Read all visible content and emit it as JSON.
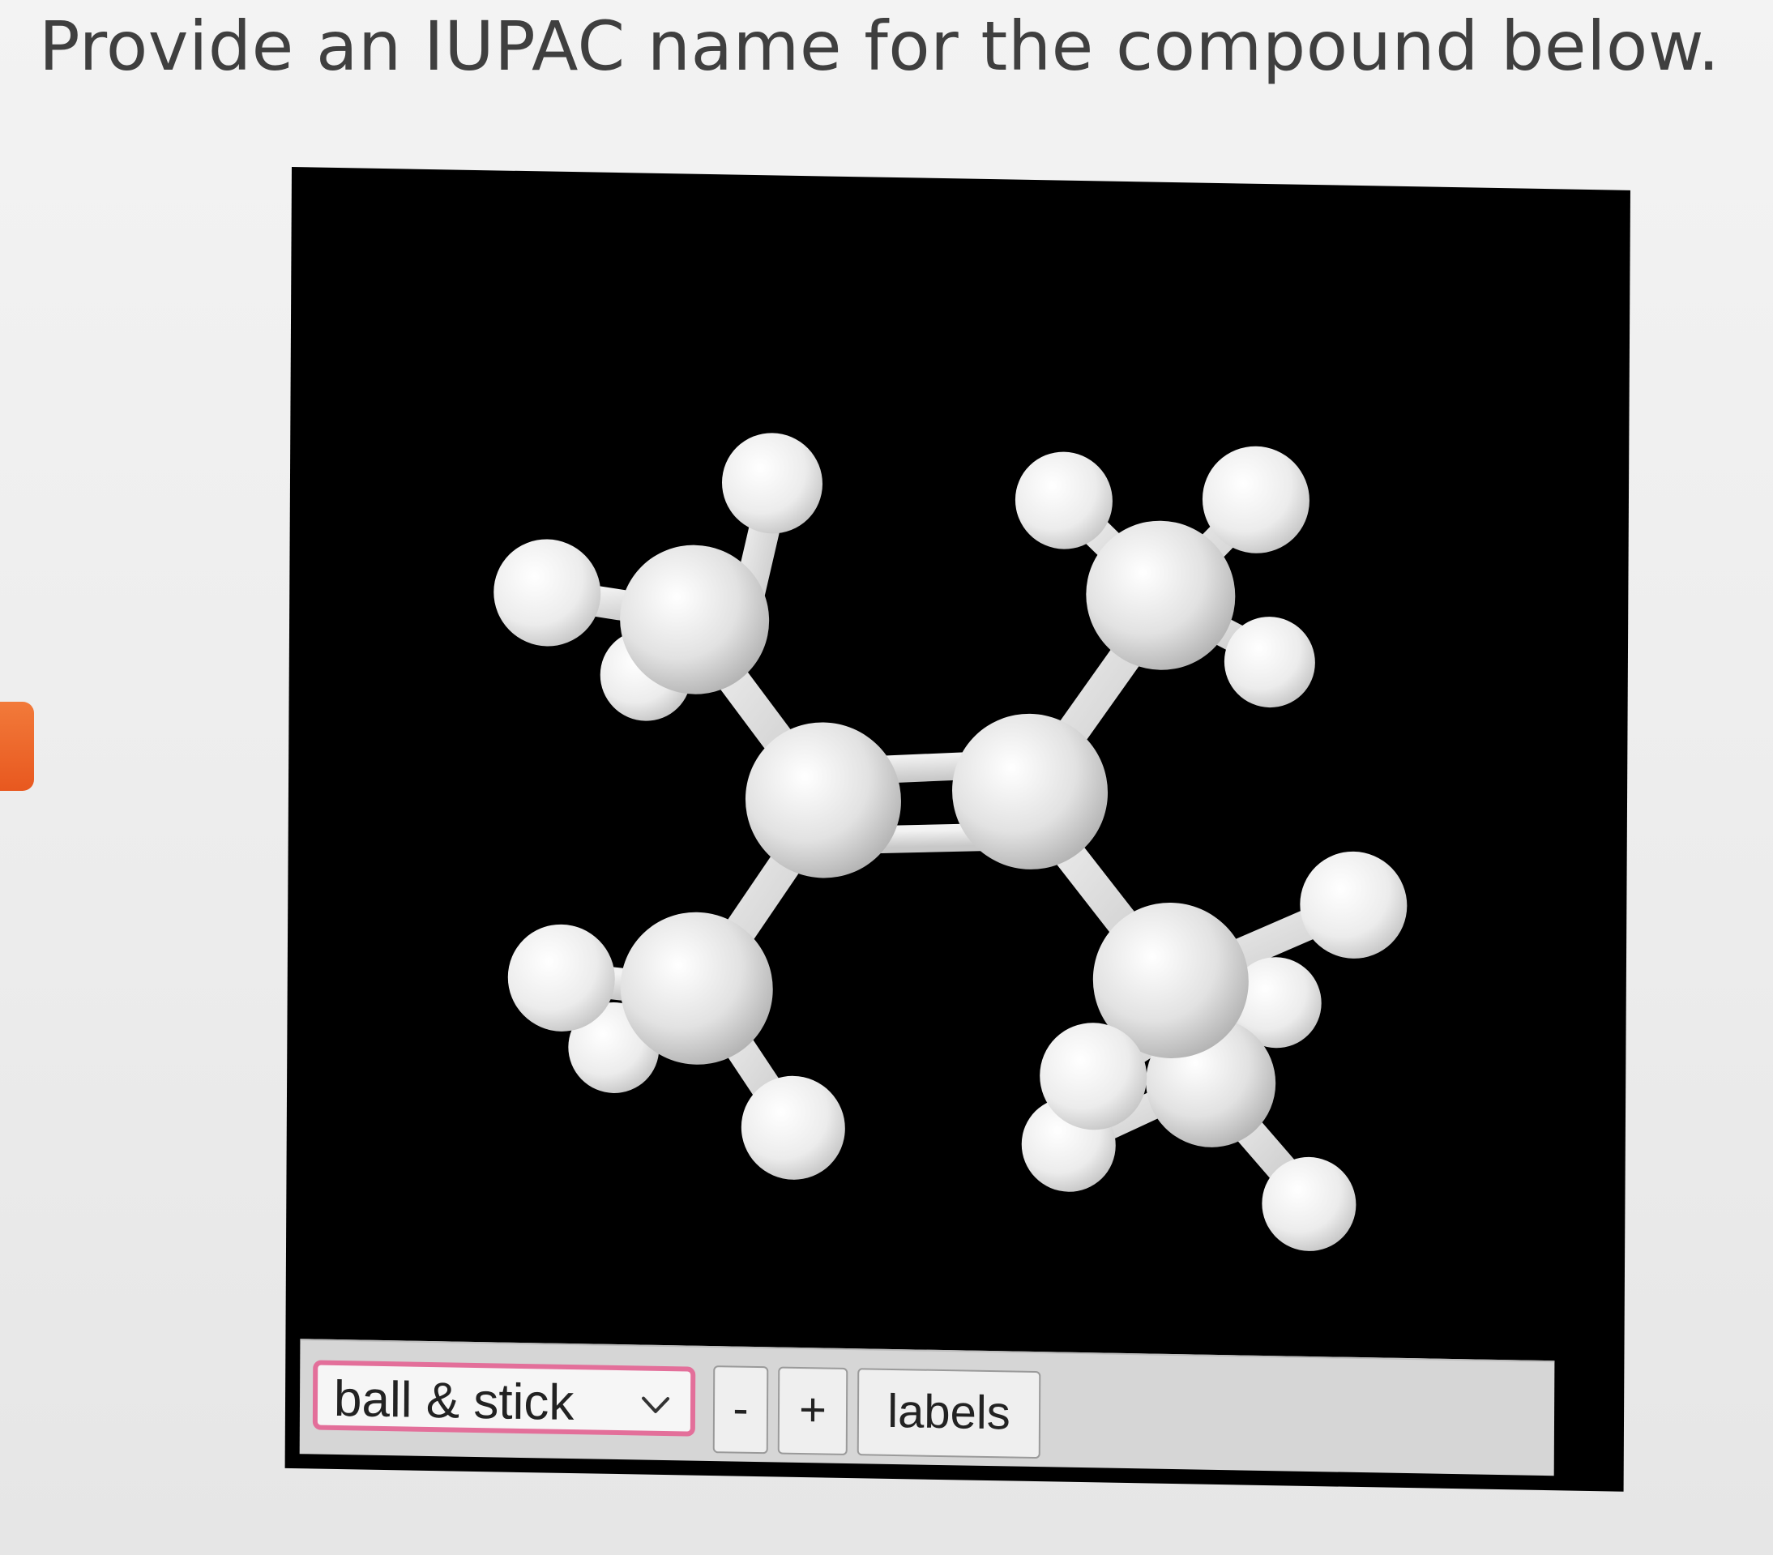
{
  "question": {
    "text": "Provide an IUPAC name for the compound below."
  },
  "viewer": {
    "style_select": {
      "selected": "ball & stick"
    },
    "zoom_out_label": "-",
    "zoom_in_label": "+",
    "labels_button": "labels"
  },
  "colors": {
    "viewer_background": "#000000",
    "atom_color": "#e4e4e4",
    "select_border": "#e36f9a",
    "side_tab": "#e8581f"
  }
}
